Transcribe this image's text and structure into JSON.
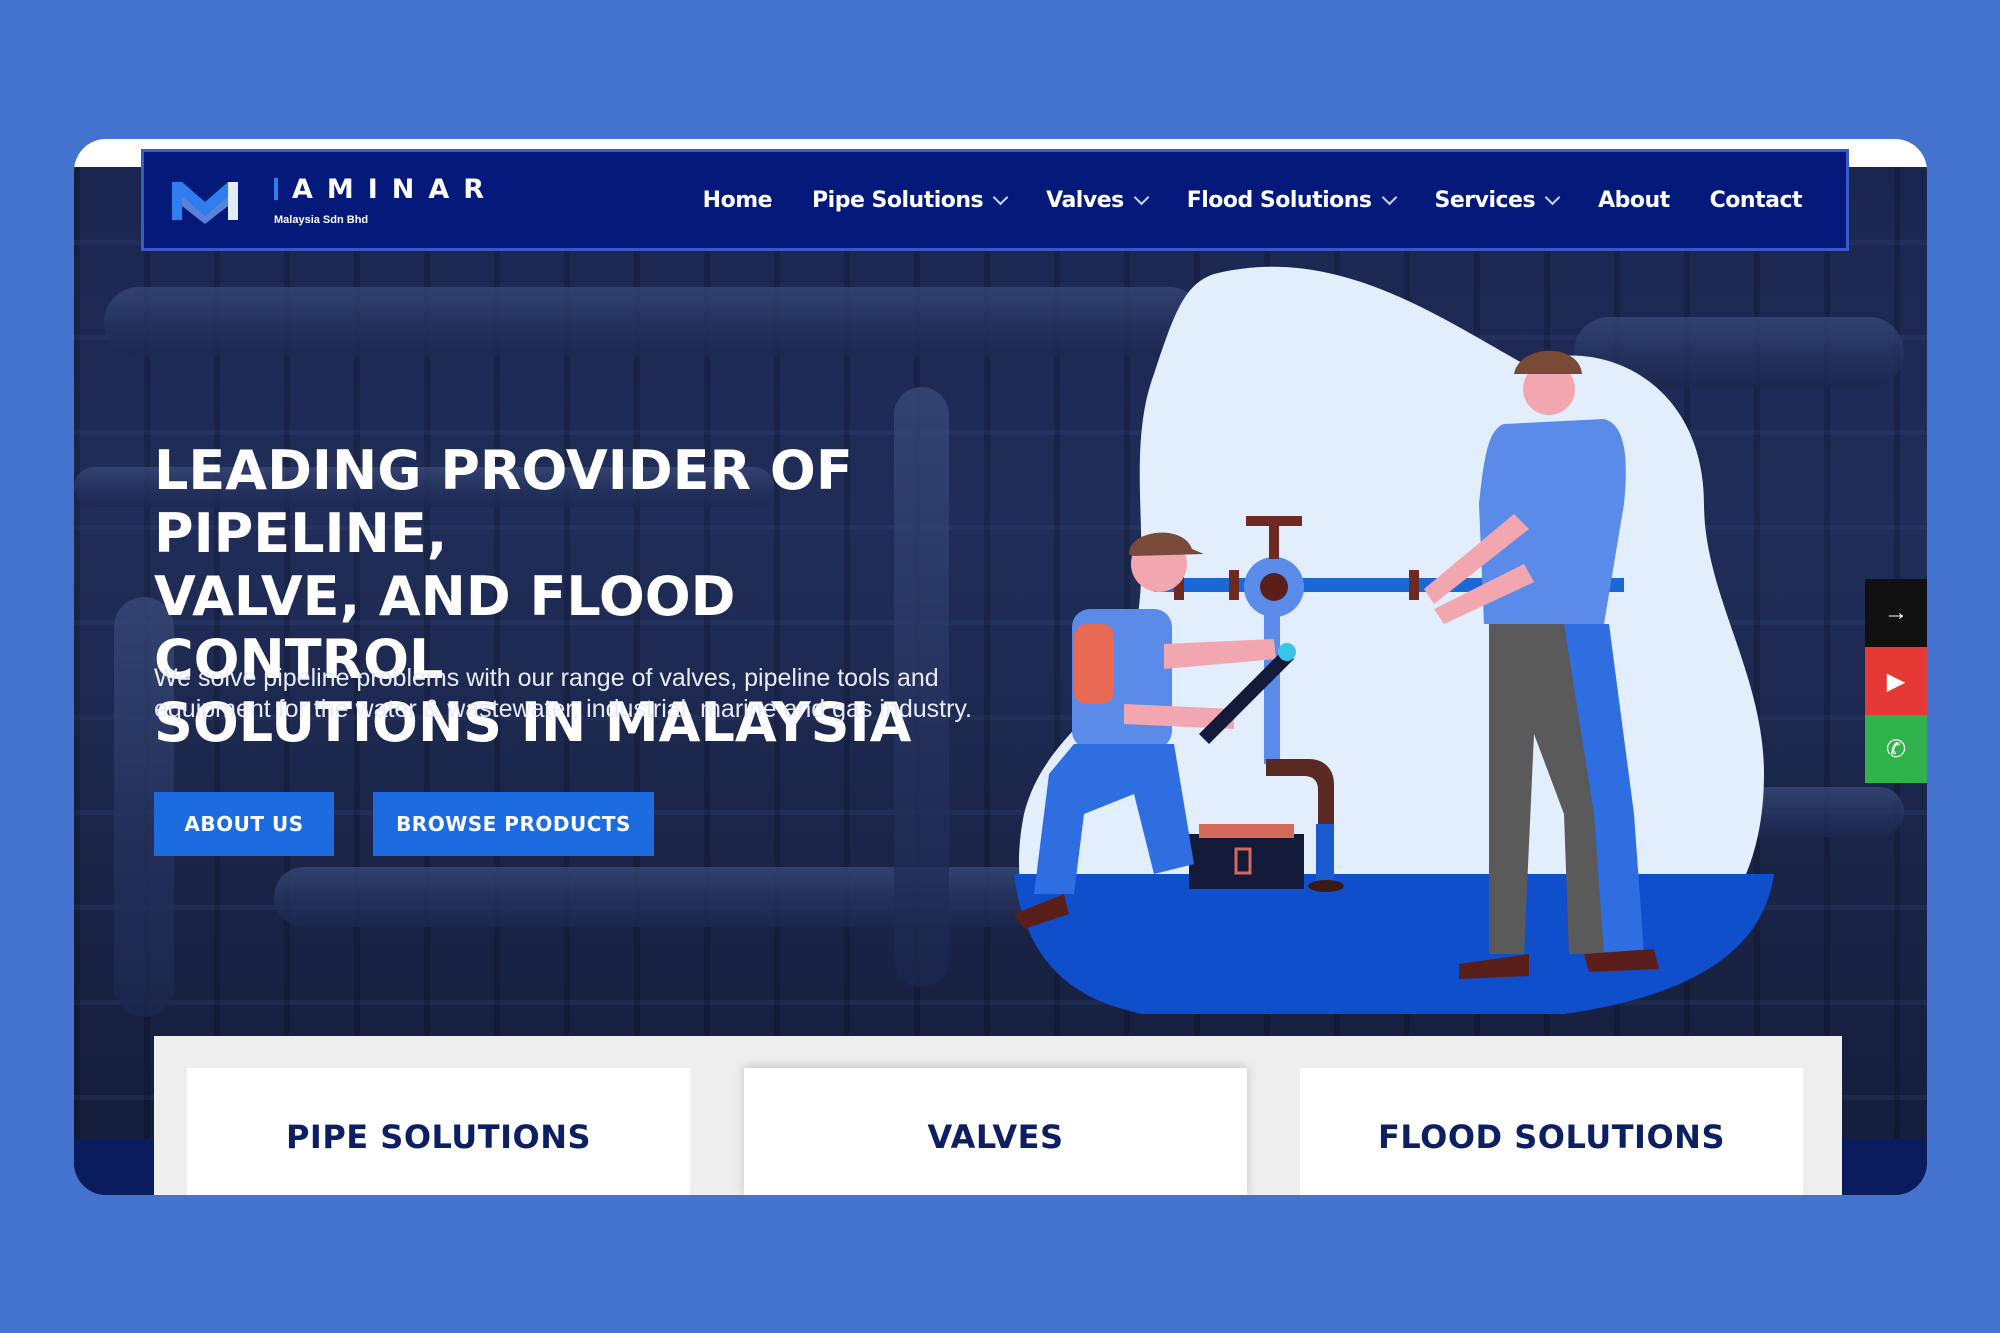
{
  "brand": {
    "name": "AMINAR",
    "subtitle": "Malaysia Sdn Bhd"
  },
  "nav": {
    "items": [
      {
        "label": "Home",
        "dropdown": false
      },
      {
        "label": "Pipe Solutions",
        "dropdown": true
      },
      {
        "label": "Valves",
        "dropdown": true
      },
      {
        "label": "Flood Solutions",
        "dropdown": true
      },
      {
        "label": "Services",
        "dropdown": true
      },
      {
        "label": "About",
        "dropdown": false
      },
      {
        "label": "Contact",
        "dropdown": false
      }
    ]
  },
  "hero": {
    "headline_line1": "LEADING PROVIDER OF PIPELINE,",
    "headline_line2": "VALVE, AND FLOOD CONTROL",
    "headline_line3": "SOLUTIONS IN MALAYSIA",
    "subtext": "We solve pipeline problems with our range of valves, pipeline tools and equipment for the water & wastewater, industrial, marine and gas industry.",
    "button_about": "ABOUT US",
    "button_browse": "BROWSE PRODUCTS"
  },
  "side_social": [
    {
      "icon": "arrow-right-icon",
      "glyph": "→",
      "color": "#111111"
    },
    {
      "icon": "youtube-icon",
      "glyph": "▶",
      "color": "#e53935"
    },
    {
      "icon": "whatsapp-icon",
      "glyph": "✆",
      "color": "#2fb34a"
    }
  ],
  "cards": [
    {
      "title": "PIPE SOLUTIONS"
    },
    {
      "title": "VALVES"
    },
    {
      "title": "FLOOD SOLUTIONS"
    }
  ],
  "colors": {
    "page_bg": "#4472cf",
    "navbar": "#04197a",
    "button": "#1c6be0",
    "card_title": "#0d1f63"
  }
}
